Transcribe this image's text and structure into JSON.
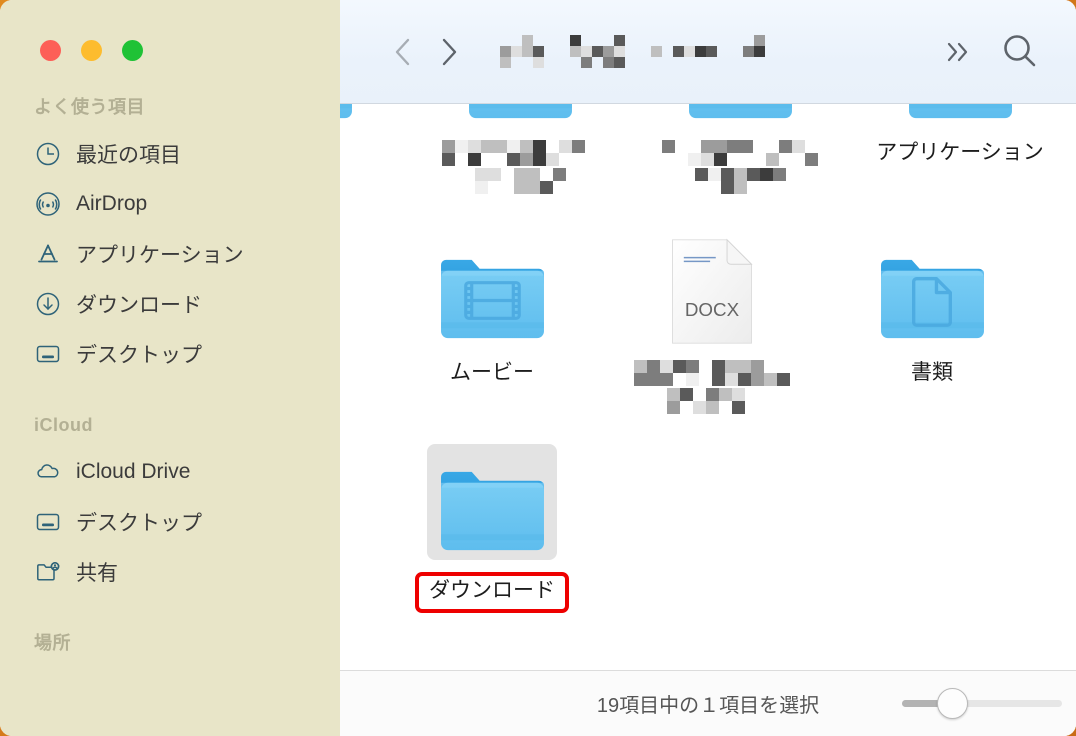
{
  "window": {
    "title_redacted": true,
    "accent_selection": "#e3e3e3",
    "annotation_color": "#ee0000",
    "desktop_background": "#d4791a"
  },
  "traffic_lights": [
    {
      "name": "close",
      "color": "#fd5f57"
    },
    {
      "name": "minimize",
      "color": "#fdbc2e"
    },
    {
      "name": "maximize",
      "color": "#1fc236"
    }
  ],
  "toolbar": {
    "back_label": "‹",
    "forward_label": "›",
    "overflow_label": "»",
    "search_label": "search",
    "path_title": ""
  },
  "sidebar": {
    "sections": [
      {
        "header": "よく使う項目",
        "items": [
          {
            "icon": "clock-icon",
            "label": "最近の項目"
          },
          {
            "icon": "airdrop-icon",
            "label": "AirDrop"
          },
          {
            "icon": "applications-icon",
            "label": "アプリケーション"
          },
          {
            "icon": "download-icon",
            "label": "ダウンロード"
          },
          {
            "icon": "desktop-icon",
            "label": "デスクトップ"
          }
        ]
      },
      {
        "header": "iCloud",
        "items": [
          {
            "icon": "cloud-icon",
            "label": "iCloud Drive"
          },
          {
            "icon": "desktop-icon",
            "label": "デスクトップ"
          },
          {
            "icon": "shared-folder-icon",
            "label": "共有"
          }
        ]
      },
      {
        "header": "場所",
        "items": []
      }
    ]
  },
  "filegrid": {
    "rows": [
      {
        "partial_top": true,
        "cells": [
          {
            "kind": "folder-blue",
            "label": "ー",
            "redacted": false,
            "truncated": true,
            "name": "file-item-partial"
          },
          {
            "kind": "folder-blue",
            "label": "",
            "redacted": true,
            "redact_lines": 2,
            "name": "file-item-redacted-1"
          },
          {
            "kind": "folder-blue",
            "label": "",
            "redacted": true,
            "redact_lines": 2,
            "name": "file-item-redacted-2"
          },
          {
            "kind": "folder-blue",
            "label": "アプリケーション",
            "redacted": false,
            "name": "file-item-applications"
          }
        ]
      },
      {
        "cells": [
          {
            "kind": "folder-movies",
            "label": "ムービー",
            "redacted": false,
            "name": "file-item-movies"
          },
          {
            "kind": "docx",
            "label": "",
            "redacted": true,
            "redact_lines": 2,
            "badge": "DOCX",
            "name": "file-item-docx"
          },
          {
            "kind": "folder-documents",
            "label": "書類",
            "redacted": false,
            "name": "file-item-documents"
          }
        ]
      },
      {
        "cells": [
          {
            "kind": "folder-plain",
            "label": "ダウンロード",
            "redacted": false,
            "selected": true,
            "annotated": true,
            "name": "file-item-downloads"
          }
        ]
      }
    ]
  },
  "statusbar": {
    "status_text": "19項目中の１項目を選択",
    "total_items": 19,
    "selected_items": 1,
    "zoom_value": 25
  }
}
